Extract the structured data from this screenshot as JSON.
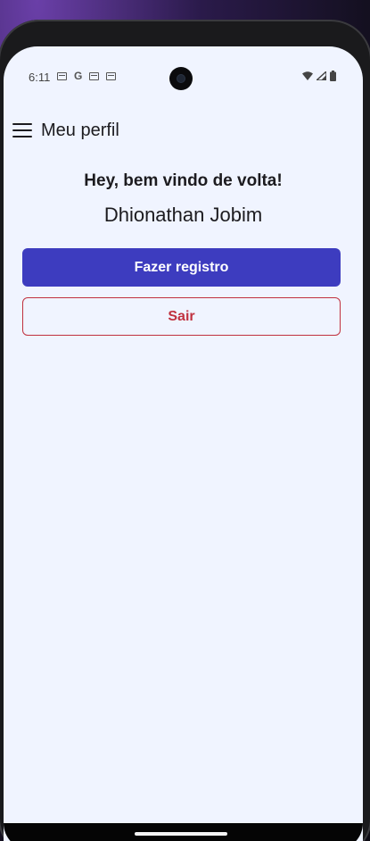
{
  "status_bar": {
    "time": "6:11",
    "left_icons": [
      "news-icon",
      "google-icon",
      "calendar-icon",
      "calendar-icon"
    ],
    "right_icons": [
      "wifi-icon",
      "signal-icon",
      "battery-icon"
    ]
  },
  "app_bar": {
    "title": "Meu perfil",
    "menu_icon": "menu-icon"
  },
  "profile": {
    "greeting": "Hey, bem vindo de volta!",
    "username": "Dhionathan Jobim"
  },
  "actions": {
    "register_label": "Fazer registro",
    "logout_label": "Sair"
  },
  "colors": {
    "background": "#f0f4ff",
    "primary": "#3d3cbf",
    "danger": "#c0313f"
  }
}
